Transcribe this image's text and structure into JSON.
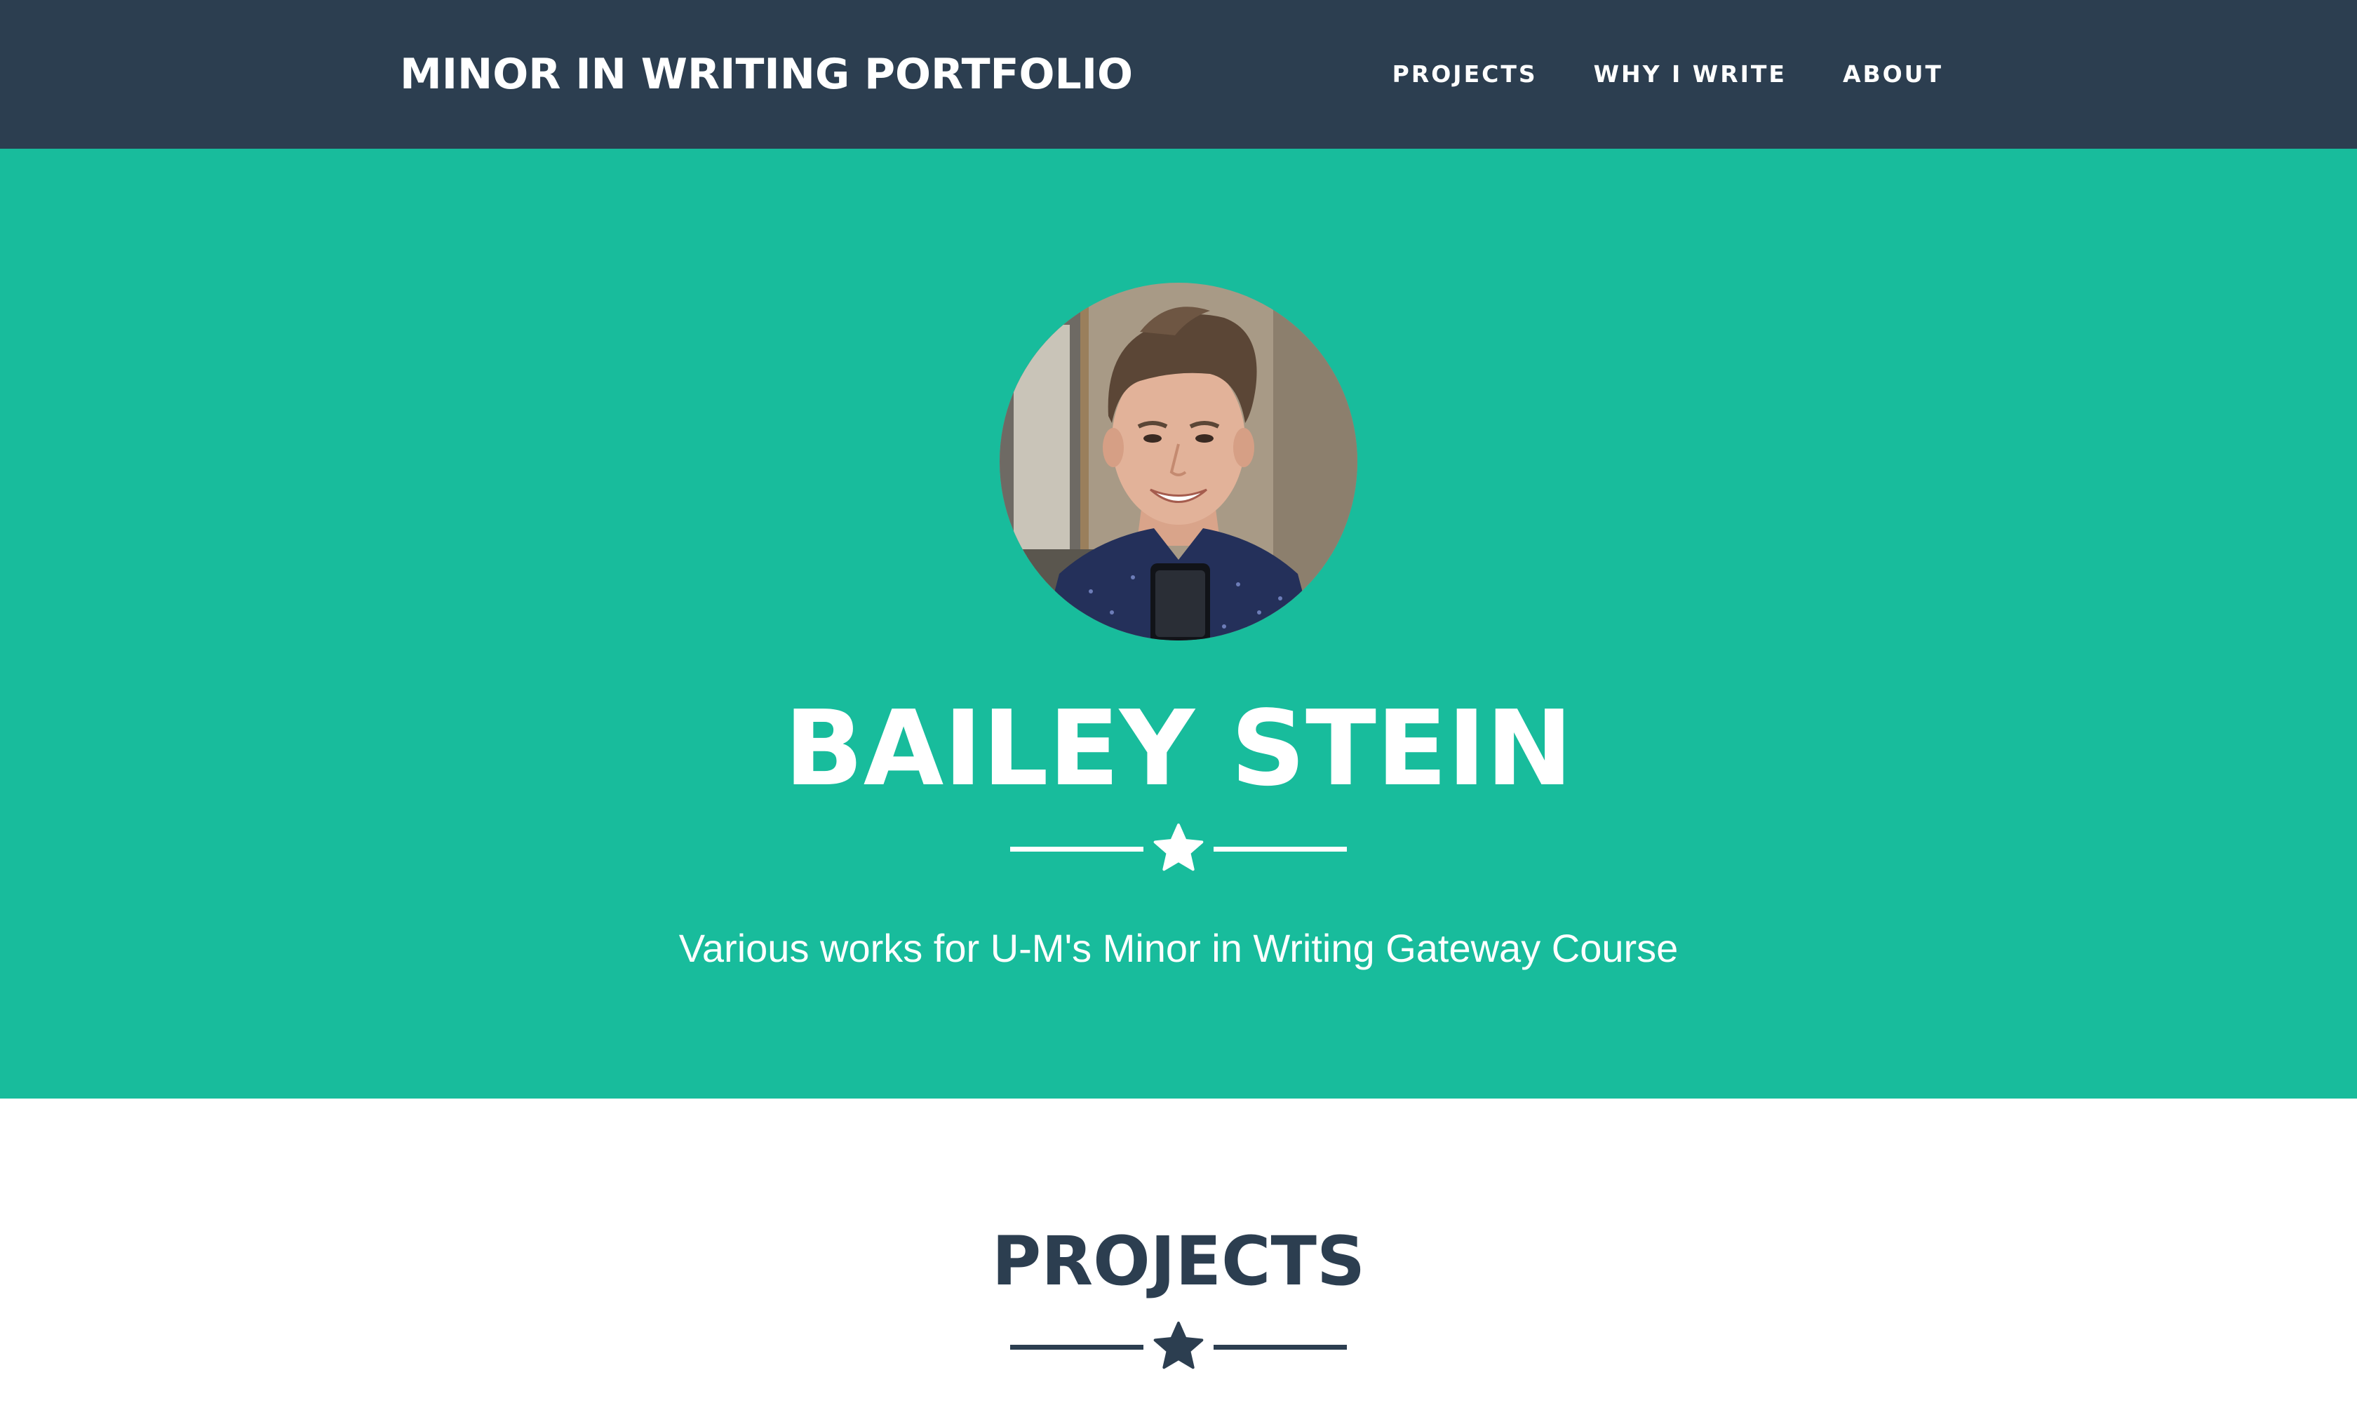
{
  "navbar": {
    "brand": "MINOR IN WRITING PORTFOLIO",
    "links": [
      "PROJECTS",
      "WHY I WRITE",
      "ABOUT"
    ]
  },
  "hero": {
    "name": "BAILEY STEIN",
    "subtitle": "Various works for U-M's Minor in Writing Gateway Course",
    "divider_icon": "star-icon"
  },
  "projects_section": {
    "title": "PROJECTS",
    "divider_icon": "star-icon"
  },
  "colors": {
    "navbar_bg": "#2c3e50",
    "accent": "#18bc9c",
    "text_light": "#ffffff",
    "text_dark": "#2c3e50"
  }
}
